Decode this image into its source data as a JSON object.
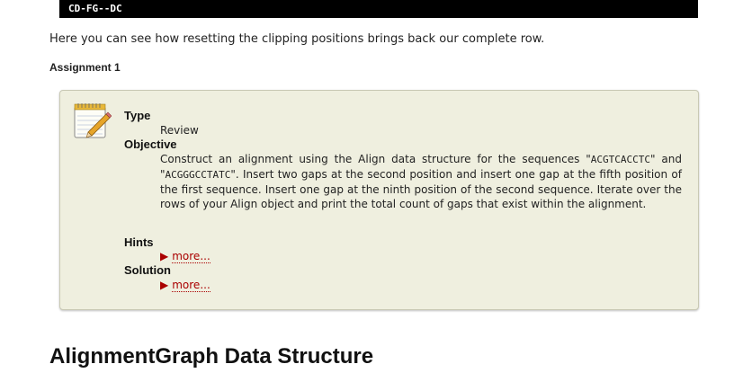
{
  "code_line": "CD-FG--DC",
  "intro_text": "Here you can see how resetting the clipping positions brings back our complete row.",
  "assignment": {
    "title": "Assignment 1",
    "type_label": "Type",
    "type_value": "Review",
    "objective_label": "Objective",
    "objective_parts": {
      "p1": "Construct an alignment using the Align data structure for the sequences \"",
      "seq1": "ACGTCACCTC",
      "p2": "\" and \"",
      "seq2": "ACGGGCCTATC",
      "p3": "\". Insert two gaps at the second position and insert one gap at the fifth position of the first sequence. Insert one gap at the ninth position of the second sequence. Iterate over the rows of your Align object and print the total count of gaps that exist within the alignment."
    },
    "hints_label": "Hints",
    "solution_label": "Solution",
    "more_label": "more..."
  },
  "section_heading": "AlignmentGraph Data Structure",
  "icon": "notepad-pencil-icon"
}
